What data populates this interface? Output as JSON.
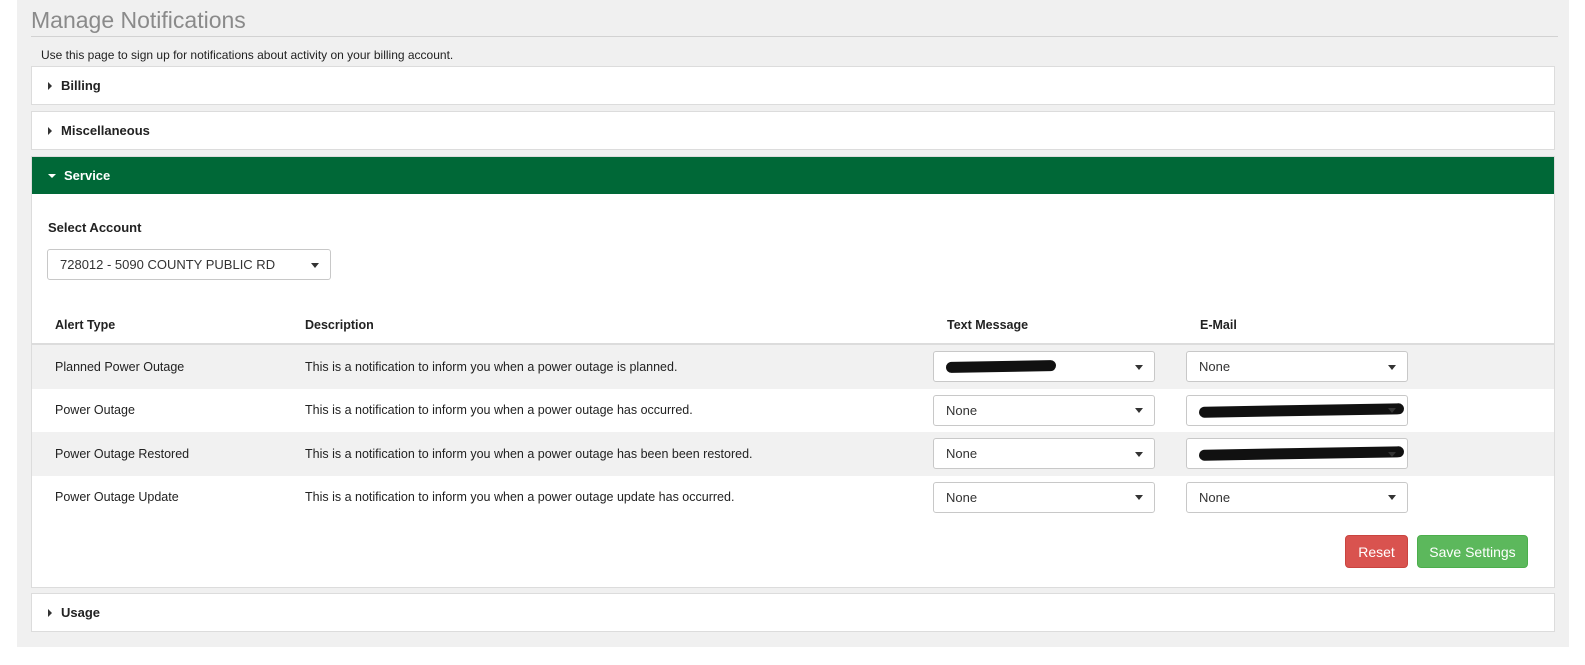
{
  "page": {
    "title": "Manage Notifications",
    "intro": "Use this page to sign up for notifications about activity on your billing account."
  },
  "sections": {
    "billing": "Billing",
    "miscellaneous": "Miscellaneous",
    "service": "Service",
    "usage": "Usage"
  },
  "service": {
    "select_account_label": "Select Account",
    "selected_account": "728012 - 5090 COUNTY PUBLIC RD",
    "columns": {
      "alert_type": "Alert Type",
      "description": "Description",
      "text_message": "Text Message",
      "email": "E-Mail"
    },
    "rows": [
      {
        "alert_type": "Planned Power Outage",
        "description": "This is a notification to inform you when a power outage is planned.",
        "text_message": "",
        "email": "None"
      },
      {
        "alert_type": "Power Outage",
        "description": "This is a notification to inform you when a power outage has occurred.",
        "text_message": "None",
        "email": ""
      },
      {
        "alert_type": "Power Outage Restored",
        "description": "This is a notification to inform you when a power outage has been been restored.",
        "text_message": "None",
        "email": ""
      },
      {
        "alert_type": "Power Outage Update",
        "description": "This is a notification to inform you when a power outage update has occurred.",
        "text_message": "None",
        "email": "None"
      }
    ],
    "buttons": {
      "reset": "Reset",
      "save": "Save Settings"
    }
  },
  "colors": {
    "service_header": "#006837",
    "reset_button": "#d9534f",
    "save_button": "#5cb85c"
  }
}
